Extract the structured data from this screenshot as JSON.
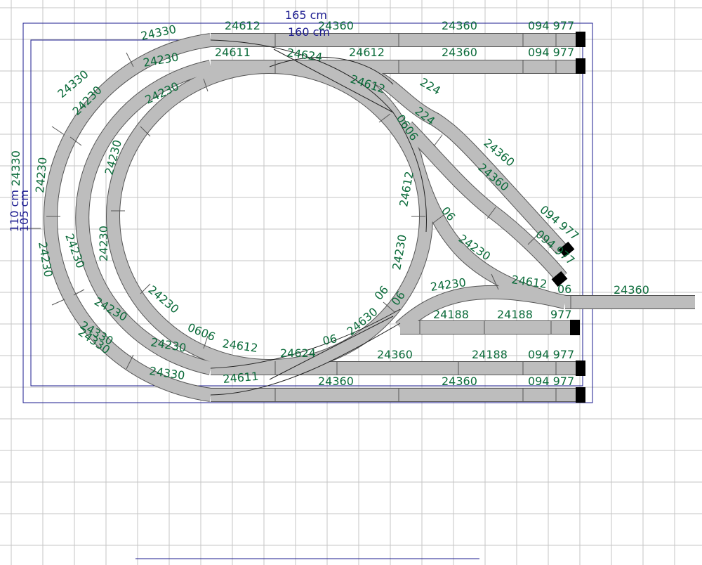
{
  "dimensions": {
    "width_outer": "165 cm",
    "width_inner": "160 cm",
    "height_outer": "110 cm",
    "height_inner": "105 cm"
  },
  "labels": [
    "24330",
    "24612",
    "24360",
    "24360",
    "094 977",
    "24230",
    "24611",
    "24624",
    "24612",
    "24360",
    "094 977",
    "24230",
    "24612",
    "224",
    "224",
    "0606",
    "24360",
    "24360",
    "24330",
    "24230",
    "24230",
    "24612",
    "094 977",
    "094 977",
    "24330",
    "24230",
    "24230",
    "06",
    "24230",
    "24230",
    "24230",
    "24612",
    "06",
    "24360",
    "24230",
    "24230",
    "24230",
    "24188",
    "24188",
    "977",
    "24330",
    "24230",
    "0606",
    "24612",
    "24624",
    "06",
    "24630",
    "06",
    "06",
    "24360",
    "24188",
    "094 977",
    "24330",
    "24611",
    "24360",
    "24360",
    "094 977",
    "24230",
    "24330"
  ],
  "colors": {
    "track": "#bdbdbd",
    "label": "#0b6b3a",
    "board": "#1b1b8f",
    "grid": "#c6c6c6"
  }
}
